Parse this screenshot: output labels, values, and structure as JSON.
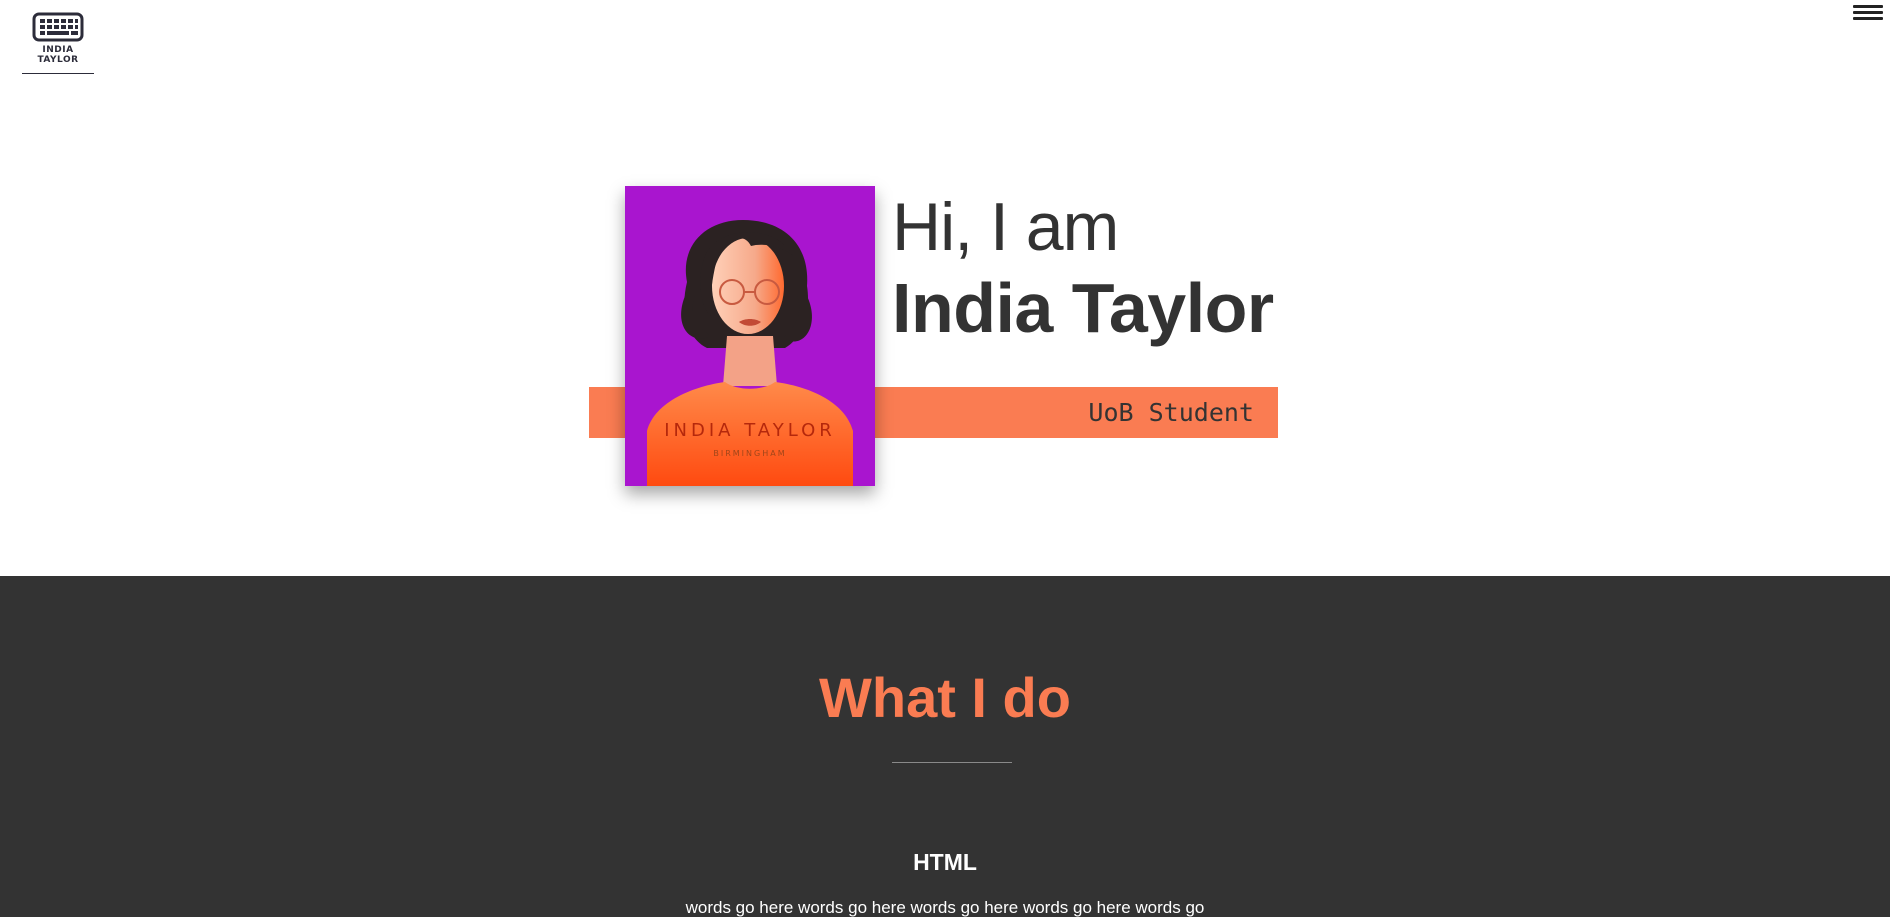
{
  "header": {
    "logo_line1": "INDIA",
    "logo_line2": "TAYLOR",
    "logo_icon": "keyboard-icon",
    "menu_icon": "hamburger-menu-icon"
  },
  "hero": {
    "greeting": "Hi, I am",
    "name": "India Taylor",
    "role": "UoB Student",
    "portrait": {
      "name_text": "INDIA TAYLOR",
      "city_text": "BIRMINGHAM"
    }
  },
  "what_i_do": {
    "title": "What I do",
    "skills": [
      {
        "title": "HTML",
        "text": "words go here words go here words go here words go here words go"
      }
    ]
  },
  "colors": {
    "accent": "#fa7c52",
    "dark_bg": "#333333",
    "portrait_bg": "#a915cf",
    "text_dark": "#333333"
  }
}
